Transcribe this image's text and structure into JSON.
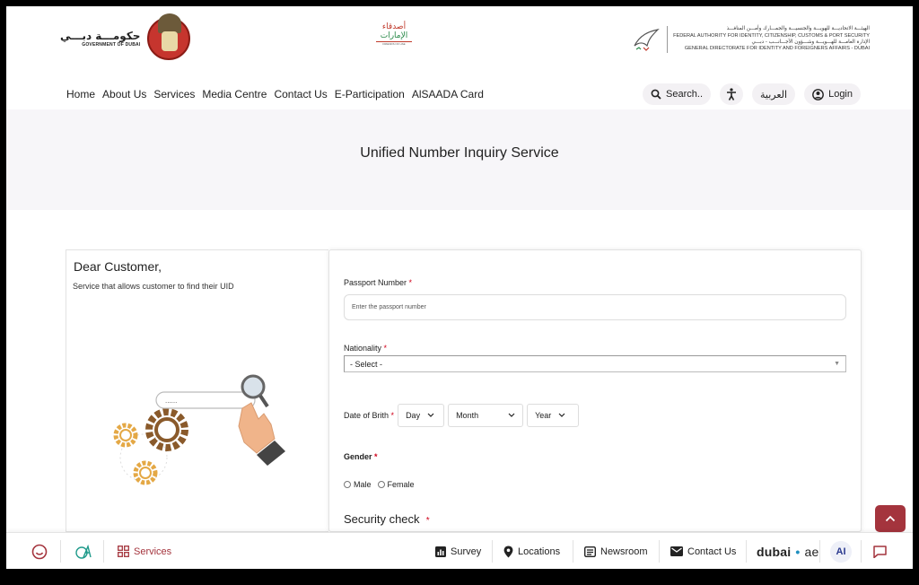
{
  "header": {
    "gov_logo": {
      "arabic": "حكومـــة دبـــي",
      "english": "GOVERNMENT OF DUBAI"
    },
    "friends_logo": {
      "line1": "أصدقاء",
      "line2": "الإمارات",
      "tagline": "FRIENDS OF UAE"
    },
    "ica_logo": {
      "line1": "الهيئـــة الاتحاديـــة للهويـــة والجنسيـــة والجمـــارك وأمـــن المنافـــذ",
      "line2": "FEDERAL AUTHORITY FOR IDENTITY, CITIZENSHIP, CUSTOMS & PORT SECURITY",
      "line3": "الإدارة العامـــة للهـــويـــة وشـــؤون الأجـــانـــب - دبـــي",
      "line4": "GENERAL DIRECTORATE FOR IDENTITY AND FOREIGNERS AFFAIRS - DUBAI"
    },
    "nav": [
      "Home",
      "About Us",
      "Services",
      "Media Centre",
      "Contact Us",
      "E-Participation",
      "AlSAADA Card"
    ],
    "search_label": "Search..",
    "language_label": "العربية",
    "login_label": "Login"
  },
  "page": {
    "title": "Unified Number Inquiry Service"
  },
  "intro": {
    "heading": "Dear Customer,",
    "description": "Service that allows customer to find their UID",
    "search_box_text": "......"
  },
  "form": {
    "passport_label": "Passport Number",
    "passport_placeholder": "Enter the passport number",
    "nationality_label": "Nationality",
    "nationality_value": "- Select -",
    "dob_label": "Date of Brith",
    "dob_day": "Day",
    "dob_month": "Month",
    "dob_year": "Year",
    "gender_label": "Gender",
    "gender_male": "Male",
    "gender_female": "Female",
    "security_label": "Security check",
    "required_mark": "*"
  },
  "bottom_bar": {
    "services_label": "Services",
    "survey_label": "Survey",
    "locations_label": "Locations",
    "newsroom_label": "Newsroom",
    "contact_label": "Contact Us",
    "dubai_logo": {
      "word": "dubai",
      "dot": "•",
      "tld": "ae"
    },
    "ai_label": "AI"
  },
  "colors": {
    "accent": "#a4343d",
    "required": "#d0021b",
    "band": "#f7f6f9"
  }
}
